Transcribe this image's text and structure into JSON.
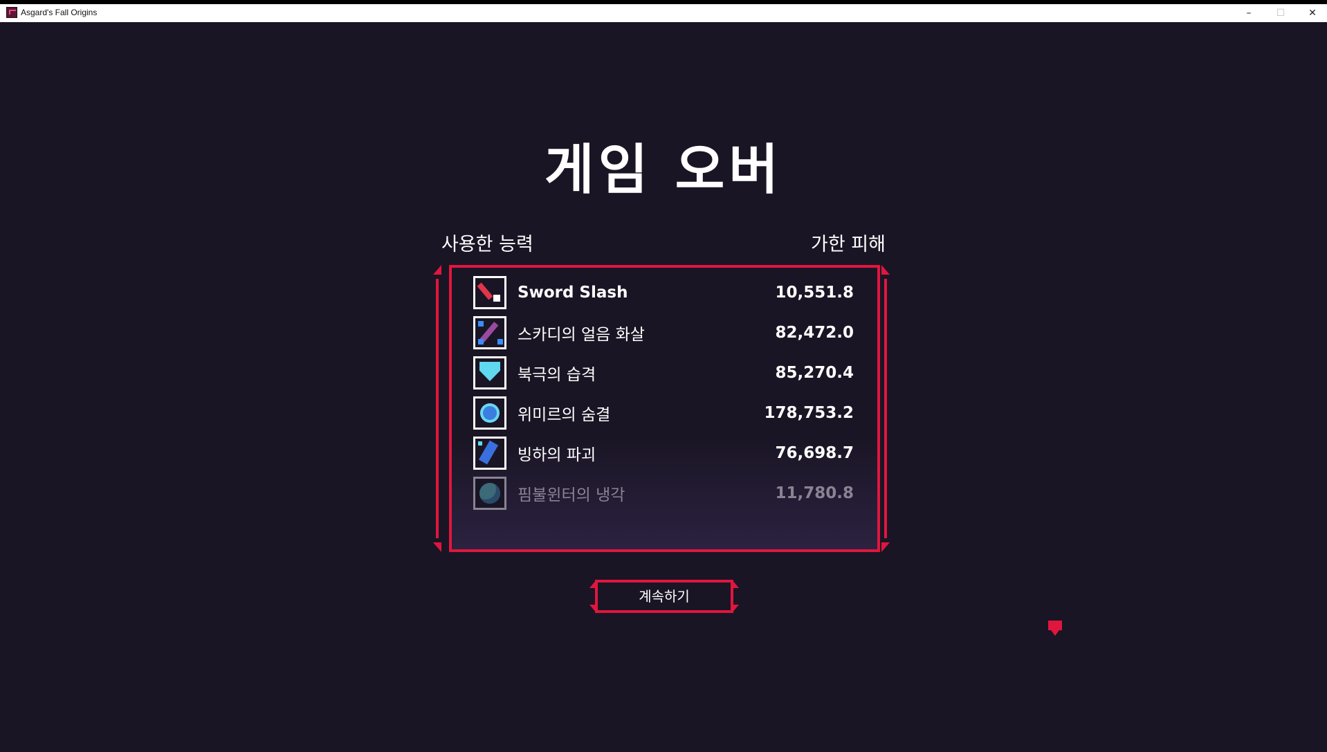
{
  "window": {
    "title": "Asgard's Fall Origins",
    "minimize": "–",
    "maximize": "☐",
    "close": "✕"
  },
  "screen": {
    "title": "게임 오버",
    "header_left": "사용한 능력",
    "header_right": "가한 피해"
  },
  "abilities": [
    {
      "name": "Sword Slash",
      "damage": "10,551.8",
      "icon": "sword-slash-icon"
    },
    {
      "name": "스카디의 얼음 화살",
      "damage": "82,472.0",
      "icon": "ice-arrow-icon"
    },
    {
      "name": "북극의 습격",
      "damage": "85,270.4",
      "icon": "arctic-shield-icon"
    },
    {
      "name": "위미르의 숨결",
      "damage": "178,753.2",
      "icon": "ymir-breath-icon"
    },
    {
      "name": "빙하의 파괴",
      "damage": "76,698.7",
      "icon": "glacier-crystal-icon"
    },
    {
      "name": "핌불윈터의 냉각",
      "damage": "11,780.8",
      "icon": "fimbulwinter-globe-icon"
    }
  ],
  "continue_label": "계속하기",
  "colors": {
    "background": "#1a1524",
    "accent": "#e0163f",
    "text": "#ffffff"
  }
}
